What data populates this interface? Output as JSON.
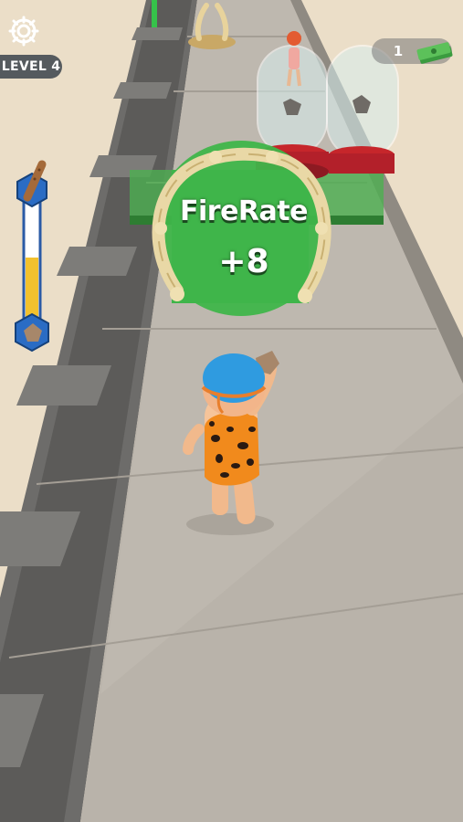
{
  "hud": {
    "level_label": "LEVEL 4",
    "money_count": "1",
    "settings_icon": "gear-icon",
    "money_icon": "cash-stack-icon",
    "weapon_icon": "club-icon",
    "ammo_icon": "rock-icon",
    "power_level": 0.5
  },
  "gate": {
    "label": "FireRate",
    "value": "+8",
    "color": "#3fb54a"
  },
  "colors": {
    "background": "#e9dcc6",
    "track": "#a9a39b",
    "hud_pill": "#555a5e",
    "meter_fill": "#f2c12e",
    "hex_badge": "#2a6cc4",
    "player_helmet": "#2f9be0"
  }
}
